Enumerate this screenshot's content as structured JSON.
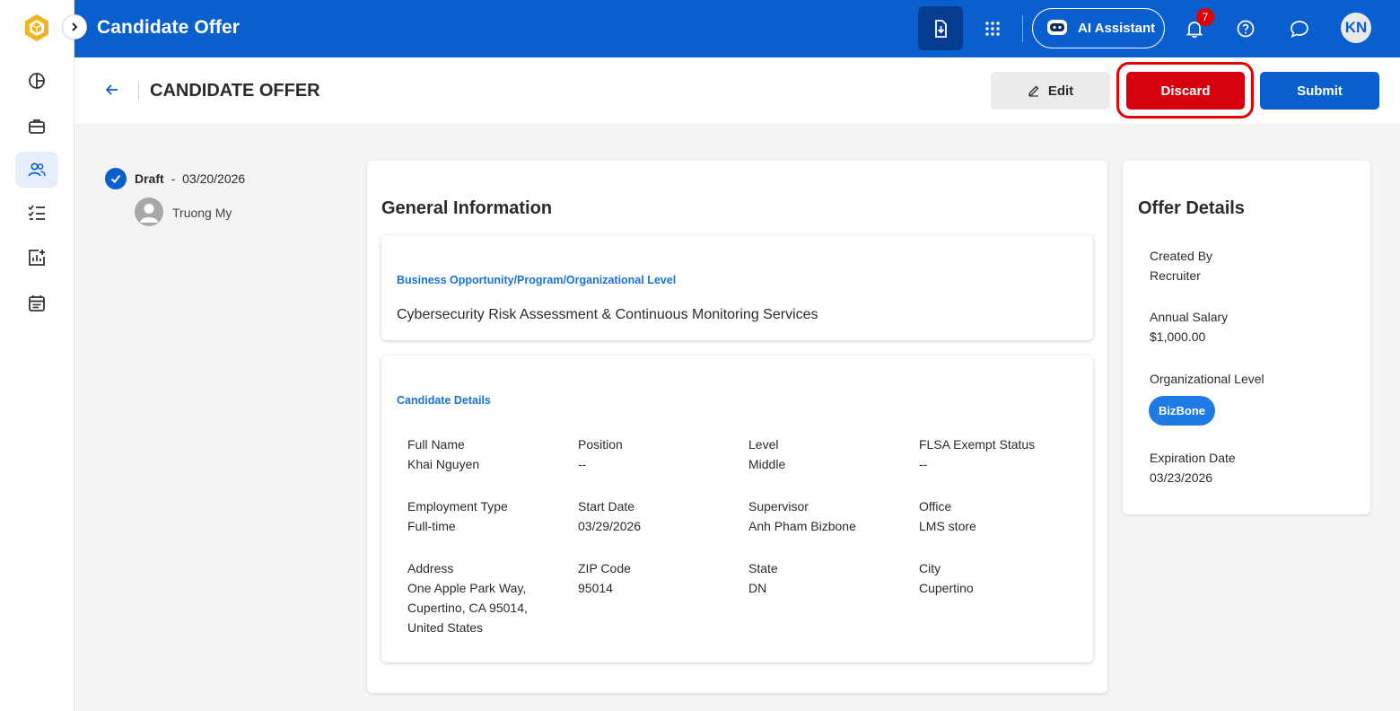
{
  "app": {
    "title": "Candidate Offer"
  },
  "topbar": {
    "ai_assistant_label": "AI Assistant",
    "notification_count": "7",
    "user_initials": "KN"
  },
  "header": {
    "title": "CANDIDATE OFFER",
    "edit_label": "Edit",
    "discard_label": "Discard",
    "submit_label": "Submit"
  },
  "timeline": {
    "status": "Draft",
    "separator": "-",
    "date": "03/20/2026",
    "user": "Truong My"
  },
  "general": {
    "title": "General Information",
    "business_section_label": "Business Opportunity/Program/Organizational Level",
    "business_value": "Cybersecurity Risk Assessment & Continuous Monitoring Services",
    "candidate_section_label": "Candidate Details",
    "fields": [
      {
        "label": "Full Name",
        "value": "Khai Nguyen"
      },
      {
        "label": "Position",
        "value": "--"
      },
      {
        "label": "Level",
        "value": "Middle"
      },
      {
        "label": "FLSA Exempt Status",
        "value": "--"
      },
      {
        "label": "Employment Type",
        "value": "Full-time"
      },
      {
        "label": "Start Date",
        "value": "03/29/2026"
      },
      {
        "label": "Supervisor",
        "value": "Anh Pham Bizbone"
      },
      {
        "label": "Office",
        "value": "LMS store"
      },
      {
        "label": "Address",
        "value": "One Apple Park Way, Cupertino, CA 95014, United States"
      },
      {
        "label": "ZIP Code",
        "value": "95014"
      },
      {
        "label": "State",
        "value": "DN"
      },
      {
        "label": "City",
        "value": "Cupertino"
      }
    ]
  },
  "offer": {
    "title": "Offer Details",
    "created_by_label": "Created By",
    "created_by_value": "Recruiter",
    "salary_label": "Annual Salary",
    "salary_value": "$1,000.00",
    "org_level_label": "Organizational Level",
    "org_level_chip": "BizBone",
    "expiration_label": "Expiration Date",
    "expiration_value": "03/23/2026"
  },
  "colors": {
    "primary": "#0a5fcf",
    "discard": "#d7000f",
    "highlight_ring": "#e60000",
    "section_label": "#1a73d4"
  },
  "icons": {
    "sidebar": [
      "dashboard-icon",
      "briefcase-icon",
      "people-icon",
      "checklist-icon",
      "report-icon",
      "calendar-icon"
    ],
    "topbar": [
      "download-icon",
      "apps-grid-icon",
      "robot-icon",
      "bell-icon",
      "help-icon",
      "chat-icon"
    ]
  }
}
